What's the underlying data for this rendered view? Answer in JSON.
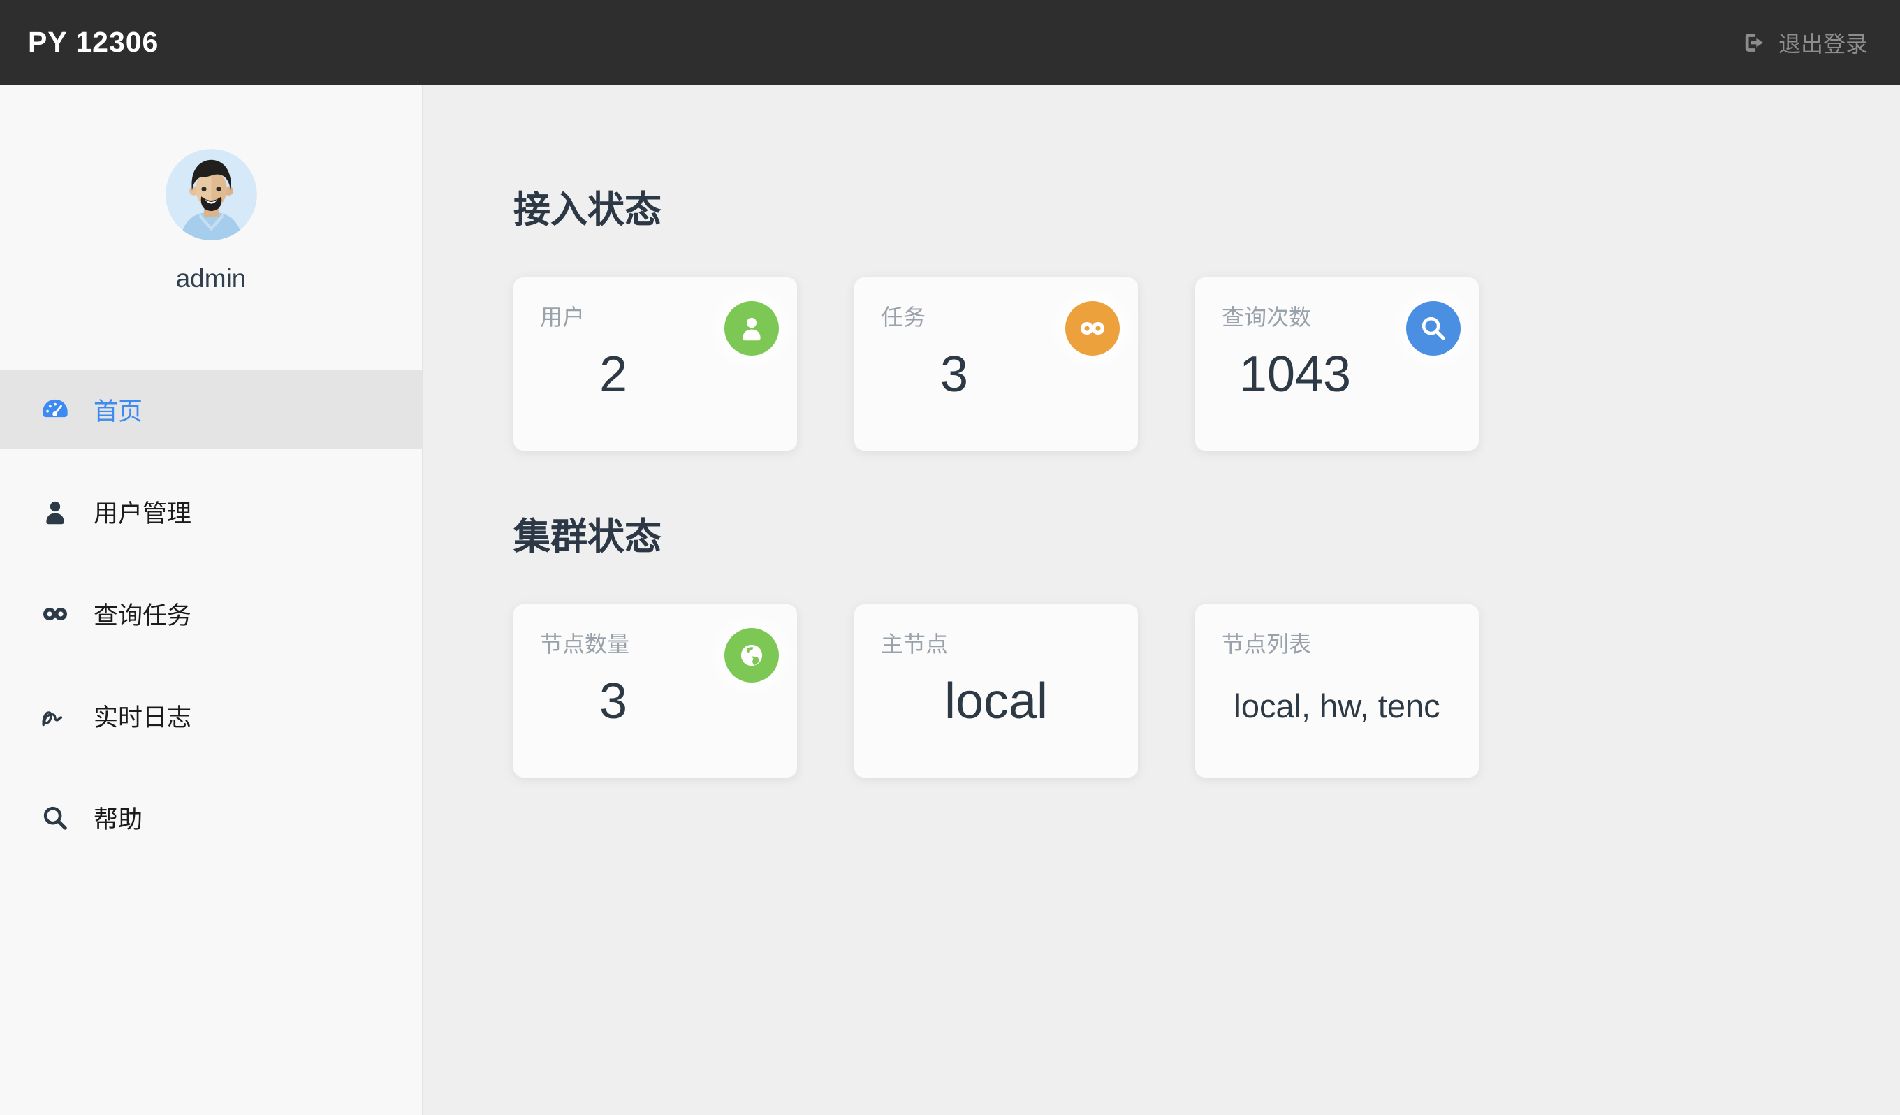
{
  "topbar": {
    "title": "PY 12306",
    "logout_label": "退出登录"
  },
  "sidebar": {
    "username": "admin",
    "items": [
      {
        "label": "首页",
        "icon": "dashboard-icon",
        "active": true
      },
      {
        "label": "用户管理",
        "icon": "user-icon",
        "active": false
      },
      {
        "label": "查询任务",
        "icon": "infinity-icon",
        "active": false
      },
      {
        "label": "实时日志",
        "icon": "signature-icon",
        "active": false
      },
      {
        "label": "帮助",
        "icon": "search-icon",
        "active": false
      }
    ]
  },
  "main": {
    "sections": [
      {
        "title": "接入状态",
        "cards": [
          {
            "label": "用户",
            "value": "2",
            "icon": "user-icon",
            "icon_color": "#7dc855"
          },
          {
            "label": "任务",
            "value": "3",
            "icon": "infinity-icon",
            "icon_color": "#eca13d"
          },
          {
            "label": "查询次数",
            "value": "1043",
            "icon": "search-icon",
            "icon_color": "#4a8fe2"
          }
        ]
      },
      {
        "title": "集群状态",
        "cards": [
          {
            "label": "节点数量",
            "value": "3",
            "icon": "globe-icon",
            "icon_color": "#7dc855"
          },
          {
            "label": "主节点",
            "value": "local"
          },
          {
            "label": "节点列表",
            "value": "local, hw, tenc"
          }
        ]
      }
    ]
  },
  "colors": {
    "topbar_bg": "#2e2e2e",
    "sidebar_bg": "#f8f8f8",
    "main_bg": "#efefef",
    "active_item_bg": "#e4e4e4",
    "accent_blue": "#3d8af2",
    "status_green": "#7dc855",
    "status_orange": "#eca13d",
    "status_blue": "#4a8fe2",
    "value_text": "#2d3a46",
    "label_text": "#99a1ab"
  }
}
